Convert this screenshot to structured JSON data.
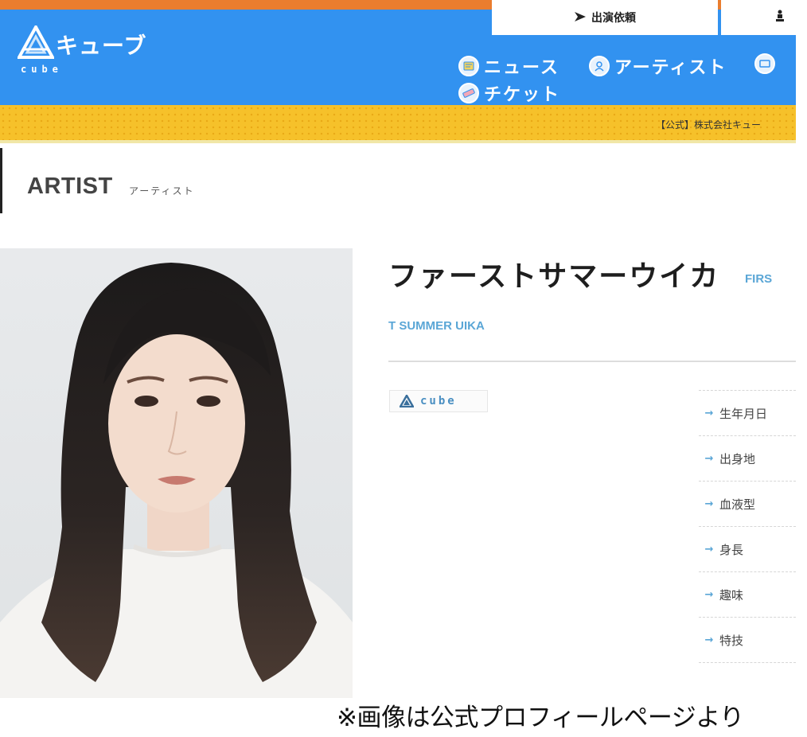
{
  "header": {
    "logo_text": "キューブ",
    "logo_sub": "cube",
    "top_tabs": [
      {
        "label": "出演依頼",
        "icon": "send-arrow-icon"
      },
      {
        "label": "",
        "icon": "chess-piece-icon"
      }
    ],
    "nav": [
      {
        "label": "ニュース",
        "icon": "news-icon"
      },
      {
        "label": "アーティスト",
        "icon": "person-icon"
      },
      {
        "label": "",
        "icon": "video-icon"
      },
      {
        "label": "チケット",
        "icon": "ticket-icon"
      }
    ],
    "colors": {
      "header": "#3292f0",
      "stripe": "#ea7d2e",
      "banner": "#f6c12a"
    }
  },
  "banner": {
    "text": "【公式】株式会社キュー"
  },
  "section": {
    "title": "ARTIST",
    "subtitle": "アーティスト"
  },
  "artist": {
    "name": "ファーストサマーウイカ",
    "roman_part1": "FIRS",
    "roman_part2": "T SUMMER UIKA",
    "agency_badge": "cube",
    "photo_alt": "artist-portrait"
  },
  "profile": {
    "items": [
      {
        "label": "生年月日"
      },
      {
        "label": "出身地"
      },
      {
        "label": "血液型"
      },
      {
        "label": "身長"
      },
      {
        "label": "趣味"
      },
      {
        "label": "特技"
      }
    ],
    "arrow": "→"
  },
  "caption": "※画像は公式プロフィールページより"
}
